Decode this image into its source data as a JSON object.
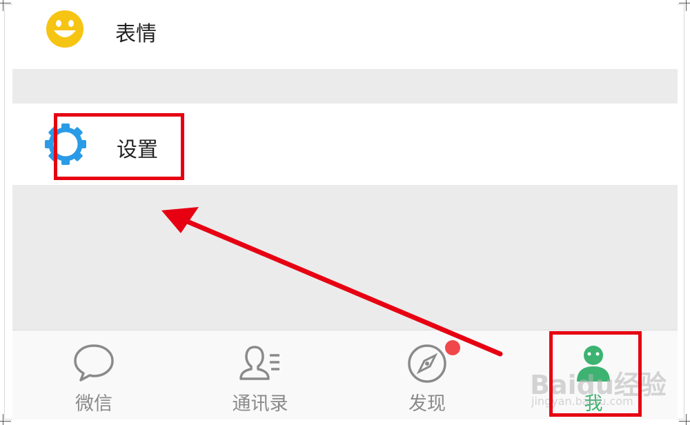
{
  "menu": {
    "emoji_label": "表情",
    "settings_label": "设置"
  },
  "tabs": [
    {
      "label": "微信",
      "icon": "chat-bubble-icon"
    },
    {
      "label": "通讯录",
      "icon": "contacts-icon"
    },
    {
      "label": "发现",
      "icon": "compass-icon",
      "badge": true
    },
    {
      "label": "我",
      "icon": "profile-icon",
      "active": true
    }
  ],
  "colors": {
    "highlight": "#e60012",
    "active_tab": "#3cb371",
    "badge": "#f0474b",
    "emoji_yellow": "#f6c413",
    "settings_blue": "#2a9be6"
  },
  "watermark": {
    "brand": "Baidu经验",
    "url": "jingyan.baidu.com"
  }
}
